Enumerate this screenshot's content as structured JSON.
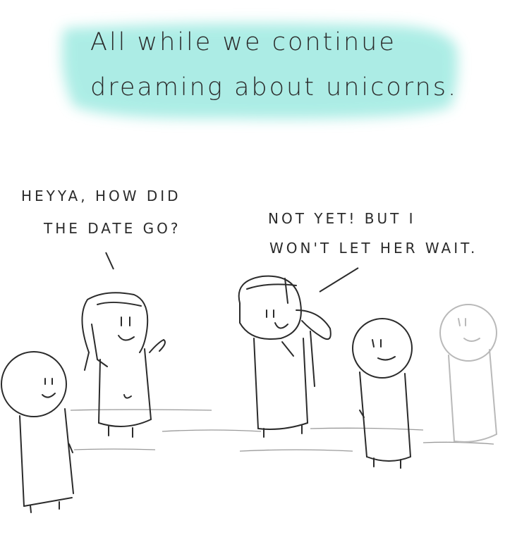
{
  "caption": {
    "lines": [
      "All while we continue",
      "dreaming about unicorns."
    ],
    "highlight_color": "#a8ece4"
  },
  "speech_left": {
    "lines": [
      "HEYYA, HOW DID",
      "THE DATE GO?"
    ]
  },
  "speech_right": {
    "lines": [
      "NOT YET! BUT I",
      "WON'T LET HER WAIT."
    ]
  },
  "characters": [
    "left-stick-figure",
    "long-hair-girl",
    "ponytail-girl",
    "right-stick-figure",
    "faded-stick-figure"
  ],
  "colors": {
    "ink": "#2b2b2b",
    "faded_ink": "#b9b9b9",
    "background": "#ffffff"
  }
}
